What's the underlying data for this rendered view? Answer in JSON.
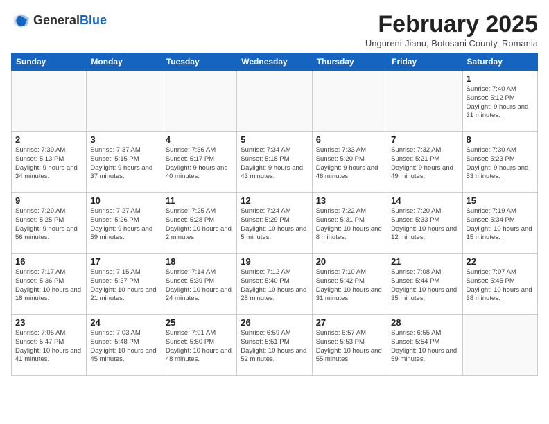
{
  "header": {
    "logo_general": "General",
    "logo_blue": "Blue",
    "month_year": "February 2025",
    "subtitle": "Ungureni-Jianu, Botosani County, Romania"
  },
  "weekdays": [
    "Sunday",
    "Monday",
    "Tuesday",
    "Wednesday",
    "Thursday",
    "Friday",
    "Saturday"
  ],
  "weeks": [
    [
      {
        "day": "",
        "info": ""
      },
      {
        "day": "",
        "info": ""
      },
      {
        "day": "",
        "info": ""
      },
      {
        "day": "",
        "info": ""
      },
      {
        "day": "",
        "info": ""
      },
      {
        "day": "",
        "info": ""
      },
      {
        "day": "1",
        "info": "Sunrise: 7:40 AM\nSunset: 5:12 PM\nDaylight: 9 hours and 31 minutes."
      }
    ],
    [
      {
        "day": "2",
        "info": "Sunrise: 7:39 AM\nSunset: 5:13 PM\nDaylight: 9 hours and 34 minutes."
      },
      {
        "day": "3",
        "info": "Sunrise: 7:37 AM\nSunset: 5:15 PM\nDaylight: 9 hours and 37 minutes."
      },
      {
        "day": "4",
        "info": "Sunrise: 7:36 AM\nSunset: 5:17 PM\nDaylight: 9 hours and 40 minutes."
      },
      {
        "day": "5",
        "info": "Sunrise: 7:34 AM\nSunset: 5:18 PM\nDaylight: 9 hours and 43 minutes."
      },
      {
        "day": "6",
        "info": "Sunrise: 7:33 AM\nSunset: 5:20 PM\nDaylight: 9 hours and 46 minutes."
      },
      {
        "day": "7",
        "info": "Sunrise: 7:32 AM\nSunset: 5:21 PM\nDaylight: 9 hours and 49 minutes."
      },
      {
        "day": "8",
        "info": "Sunrise: 7:30 AM\nSunset: 5:23 PM\nDaylight: 9 hours and 53 minutes."
      }
    ],
    [
      {
        "day": "9",
        "info": "Sunrise: 7:29 AM\nSunset: 5:25 PM\nDaylight: 9 hours and 56 minutes."
      },
      {
        "day": "10",
        "info": "Sunrise: 7:27 AM\nSunset: 5:26 PM\nDaylight: 9 hours and 59 minutes."
      },
      {
        "day": "11",
        "info": "Sunrise: 7:25 AM\nSunset: 5:28 PM\nDaylight: 10 hours and 2 minutes."
      },
      {
        "day": "12",
        "info": "Sunrise: 7:24 AM\nSunset: 5:29 PM\nDaylight: 10 hours and 5 minutes."
      },
      {
        "day": "13",
        "info": "Sunrise: 7:22 AM\nSunset: 5:31 PM\nDaylight: 10 hours and 8 minutes."
      },
      {
        "day": "14",
        "info": "Sunrise: 7:20 AM\nSunset: 5:33 PM\nDaylight: 10 hours and 12 minutes."
      },
      {
        "day": "15",
        "info": "Sunrise: 7:19 AM\nSunset: 5:34 PM\nDaylight: 10 hours and 15 minutes."
      }
    ],
    [
      {
        "day": "16",
        "info": "Sunrise: 7:17 AM\nSunset: 5:36 PM\nDaylight: 10 hours and 18 minutes."
      },
      {
        "day": "17",
        "info": "Sunrise: 7:15 AM\nSunset: 5:37 PM\nDaylight: 10 hours and 21 minutes."
      },
      {
        "day": "18",
        "info": "Sunrise: 7:14 AM\nSunset: 5:39 PM\nDaylight: 10 hours and 24 minutes."
      },
      {
        "day": "19",
        "info": "Sunrise: 7:12 AM\nSunset: 5:40 PM\nDaylight: 10 hours and 28 minutes."
      },
      {
        "day": "20",
        "info": "Sunrise: 7:10 AM\nSunset: 5:42 PM\nDaylight: 10 hours and 31 minutes."
      },
      {
        "day": "21",
        "info": "Sunrise: 7:08 AM\nSunset: 5:44 PM\nDaylight: 10 hours and 35 minutes."
      },
      {
        "day": "22",
        "info": "Sunrise: 7:07 AM\nSunset: 5:45 PM\nDaylight: 10 hours and 38 minutes."
      }
    ],
    [
      {
        "day": "23",
        "info": "Sunrise: 7:05 AM\nSunset: 5:47 PM\nDaylight: 10 hours and 41 minutes."
      },
      {
        "day": "24",
        "info": "Sunrise: 7:03 AM\nSunset: 5:48 PM\nDaylight: 10 hours and 45 minutes."
      },
      {
        "day": "25",
        "info": "Sunrise: 7:01 AM\nSunset: 5:50 PM\nDaylight: 10 hours and 48 minutes."
      },
      {
        "day": "26",
        "info": "Sunrise: 6:59 AM\nSunset: 5:51 PM\nDaylight: 10 hours and 52 minutes."
      },
      {
        "day": "27",
        "info": "Sunrise: 6:57 AM\nSunset: 5:53 PM\nDaylight: 10 hours and 55 minutes."
      },
      {
        "day": "28",
        "info": "Sunrise: 6:55 AM\nSunset: 5:54 PM\nDaylight: 10 hours and 59 minutes."
      },
      {
        "day": "",
        "info": ""
      }
    ]
  ]
}
